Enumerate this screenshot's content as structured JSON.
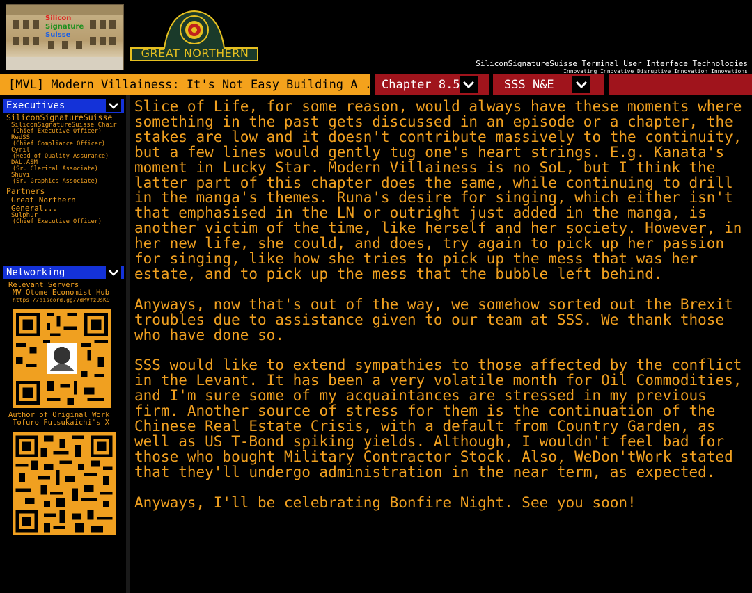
{
  "header": {
    "brand_lines": [
      "Silicon",
      "Signature",
      "Suisse"
    ],
    "partner_logo_text": "GREAT NORTHERN",
    "tagline": "SiliconSignatureSuisse Terminal User Interface Technologies",
    "subtagline": "Innovating Innovative Disruptive Innovation Innovations"
  },
  "nav": {
    "title": "[MVL] Modern Villainess: It's Not Easy Building A ...",
    "chapter": "Chapter 8.5",
    "section": "SSS N&E"
  },
  "executives": {
    "header": "Executives",
    "org1": "SiliconSignatureSuisse",
    "people": [
      {
        "name": "SiliconSignatureSuisse Chair",
        "role": "(Chief Executive Officer)"
      },
      {
        "name": "RedSS",
        "role": "(Chief Compliance Officer)"
      },
      {
        "name": "Cyril",
        "role": "(Head of Quality Assurance)"
      },
      {
        "name": "DAL.ASM",
        "role": "(Sr. Clerical Associate)"
      },
      {
        "name": "Shuvi",
        "role": "(Sr. Graphics Associate)"
      }
    ],
    "partners_label": "Partners",
    "partner_name": "Great Northern General...",
    "partner_person": {
      "name": "Sulphur",
      "role": "(Chief Executive Officer)"
    }
  },
  "networking": {
    "header": "Networking",
    "servers_label": "Relevant Servers",
    "server_name": "MV Otome Economist Hub",
    "server_url": "https://discord.gg/7dMVfzUsK9",
    "author_label": "Author of Original Work",
    "author_name": "Tofuro Futsukaichi's X"
  },
  "content": {
    "paragraphs": [
      "Slice of Life, for some reason, would always have these moments where something in the past gets discussed in an episode or a chapter, the stakes are low and it doesn't contribute massively to the continuity, but a few lines would gently tug one's heart strings. E.g. Kanata's moment in Lucky Star. Modern Villainess is no SoL, but I think the latter part of this chapter does the same, while continuing to drill in the manga's themes. Runa's desire for singing, which either isn't that emphasised in the LN or outright just added in the manga, is another victim of the time, like herself and her society. However, in her new life, she could, and does, try again to pick up her passion for singing, like how she tries to pick up the mess that was her estate, and to pick up the mess that the bubble left behind.",
      "Anyways, now that's out of the way, we somehow sorted out the Brexit troubles due to assistance given to our team at SSS. We thank those who have done so.",
      "SSS would like to extend sympathies to those affected by the conflict in the Levant. It has been a very volatile month for Oil Commodities, and I'm sure some of my acquaintances are stressed in my previous firm. Another source of stress for them is the continuation of the Chinese Real Estate Crisis, with a default from Country Garden, as well as US T-Bond spiking yields. Although, I wouldn't feel bad for those who bought Military Contractor Stock. Also, WeDon'tWork stated that they'll undergo administration in the near term, as expected.",
      "Anyways, I'll be celebrating Bonfire Night. See you soon!"
    ]
  }
}
